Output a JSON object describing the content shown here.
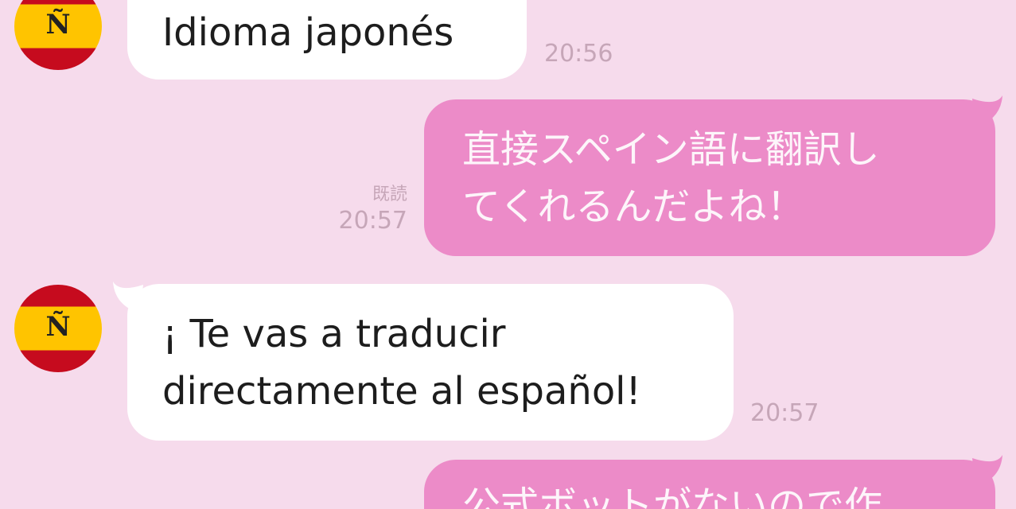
{
  "colors": {
    "background": "#f6dbec",
    "incoming_bubble": "#ffffff",
    "outgoing_bubble": "#ec8bc8",
    "meta_text": "#c6a6b8"
  },
  "messages": [
    {
      "direction": "incoming",
      "avatar_icon": "spain-flag-icon",
      "avatar_letter": "Ñ",
      "text": "Idioma japonés",
      "time": "20:56"
    },
    {
      "direction": "outgoing",
      "text_line1": "直接スペイン語に翻訳し",
      "text_line2": "てくれるんだよね！",
      "read": "既読",
      "time": "20:57"
    },
    {
      "direction": "incoming",
      "avatar_icon": "spain-flag-icon",
      "avatar_letter": "Ñ",
      "text_line1": "¡ Te vas a traducir",
      "text_line2": "directamente al español!",
      "time": "20:57"
    },
    {
      "direction": "outgoing",
      "text_line1": "公式ボットがないので作"
    }
  ]
}
